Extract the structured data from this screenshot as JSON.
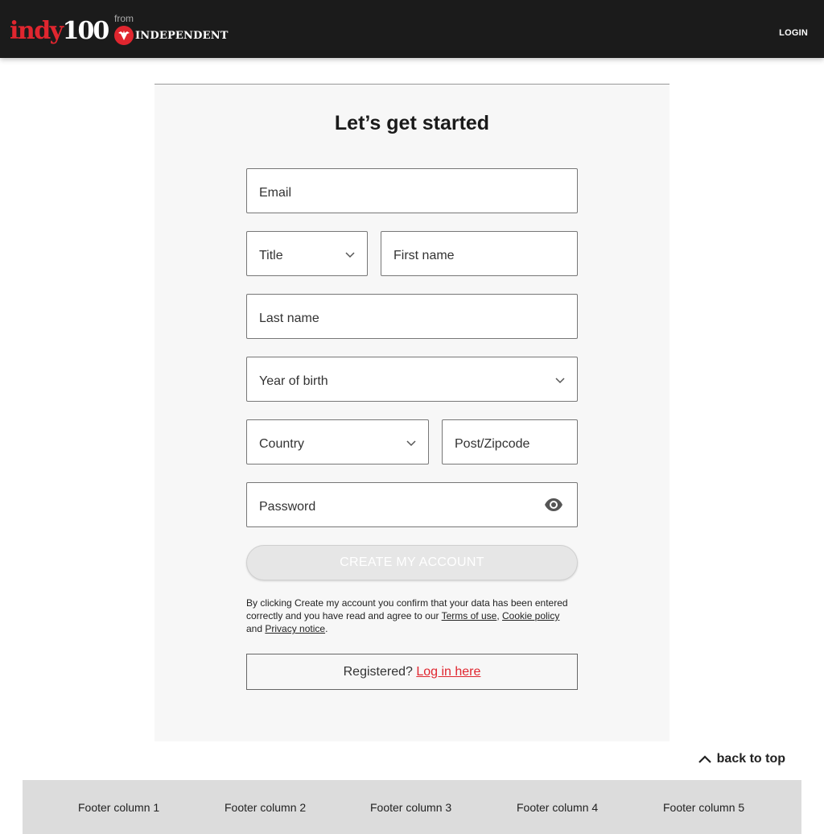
{
  "header": {
    "logo_indy": "indy",
    "logo_100": "100",
    "from_text": "from",
    "independent_text": "INDEPENDENT",
    "login_label": "LOGIN"
  },
  "form": {
    "heading": "Let’s get started",
    "email_label": "Email",
    "title_label": "Title",
    "first_name_label": "First name",
    "last_name_label": "Last name",
    "year_of_birth_label": "Year of birth",
    "country_label": "Country",
    "postcode_label": "Post/Zipcode",
    "password_label": "Password",
    "create_button_label": "CREATE MY ACCOUNT",
    "terms_prefix": "By clicking Create my account you confirm that your data has been entered correctly and you have read and agree to our ",
    "terms_of_use": "Terms of use",
    "comma": ", ",
    "cookie_policy": "Cookie policy",
    "and_text": " and ",
    "privacy_notice": "Privacy notice",
    "period": ".",
    "registered_text": "Registered? ",
    "login_here": "Log in here"
  },
  "back_to_top": "back to top",
  "footer": {
    "columns": [
      "Footer column 1",
      "Footer column 2",
      "Footer column 3",
      "Footer column 4",
      "Footer column 5"
    ]
  },
  "colors": {
    "brand_red": "#e0262f",
    "header_bg": "#1b1b1b",
    "card_bg": "#f7f7f7",
    "footer_bg": "#dcdcdc",
    "disabled_button_bg": "#e6e6e6"
  },
  "icons": {
    "chevron": "chevron-down-icon",
    "eye": "eye-icon",
    "eagle": "eagle-icon",
    "back_to_top": "chevron-up-icon"
  }
}
